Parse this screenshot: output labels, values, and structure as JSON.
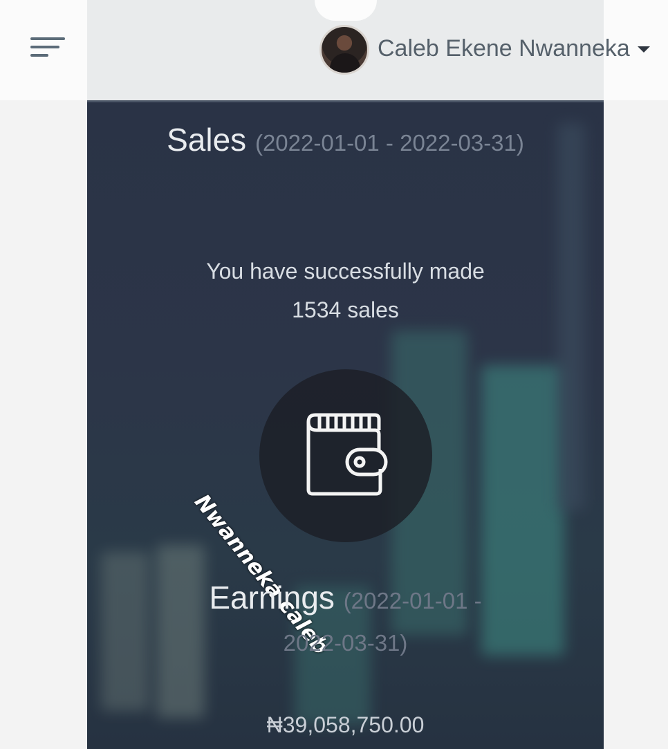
{
  "header": {
    "menu_icon": "hamburger-menu-icon",
    "user": {
      "name": "Caleb Ekene Nwanneka",
      "avatar_icon": "user-avatar",
      "dropdown_icon": "caret-down-icon"
    }
  },
  "sales": {
    "title": "Sales",
    "date_range": "(2022-01-01 - 2022-03-31)",
    "message": "You have successfully made 1534 sales",
    "icon": "wallet-icon"
  },
  "watermark": "Nwanneka caleb",
  "earnings": {
    "title": "Earnings",
    "date_range": "(2022-01-01 - 2022-03-31)",
    "amount": "₦39,058,750.00"
  },
  "colors": {
    "panel_background": "#2a3346",
    "header_background": "#e9ebec",
    "accent_teal": "#3f8f86"
  }
}
